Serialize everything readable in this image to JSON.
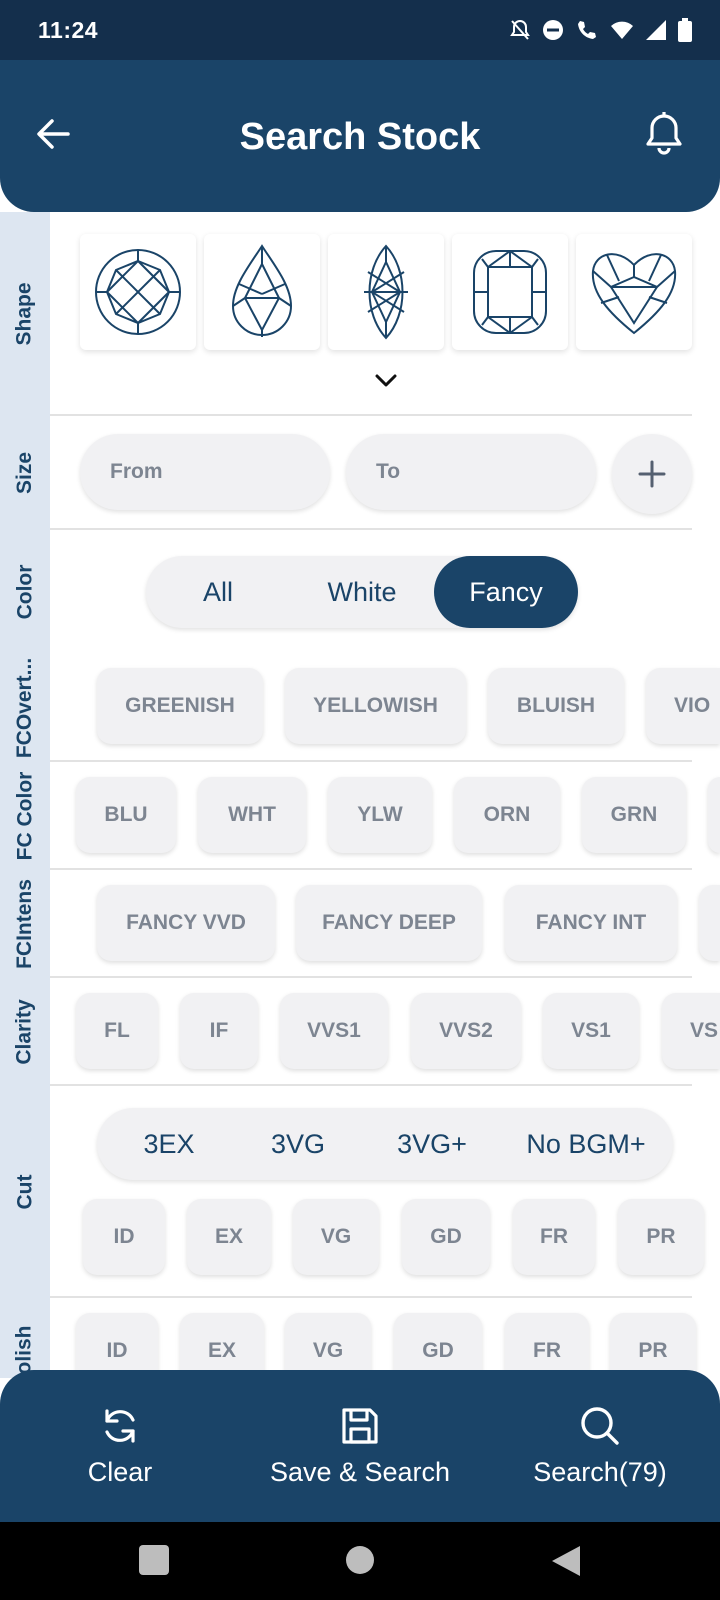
{
  "status_bar": {
    "time": "11:24"
  },
  "header": {
    "title": "Search Stock"
  },
  "sections": {
    "shape": "Shape",
    "size": "Size",
    "color": "Color",
    "fc_overtone": "FCOvert...",
    "fc_color": "FC Color",
    "fc_intensity": "FCIntens",
    "clarity": "Clarity",
    "cut": "Cut",
    "polish": "olish"
  },
  "size": {
    "from_placeholder": "From",
    "to_placeholder": "To"
  },
  "color_toggle": {
    "options": [
      "All",
      "White",
      "Fancy"
    ],
    "selected": "Fancy"
  },
  "fc_overtone_chips": [
    "GREENISH",
    "YELLOWISH",
    "BLUISH",
    "VIO"
  ],
  "fc_color_chips": [
    "BLU",
    "WHT",
    "YLW",
    "ORN",
    "GRN"
  ],
  "fc_intensity_chips": [
    "FANCY VVD",
    "FANCY DEEP",
    "FANCY INT"
  ],
  "clarity_chips": [
    "FL",
    "IF",
    "VVS1",
    "VVS2",
    "VS1",
    "VS"
  ],
  "cut_presets": [
    "3EX",
    "3VG",
    "3VG+",
    "No BGM+"
  ],
  "cut_chips": [
    "ID",
    "EX",
    "VG",
    "GD",
    "FR",
    "PR"
  ],
  "polish_chips": [
    "ID",
    "EX",
    "VG",
    "GD",
    "FR",
    "PR"
  ],
  "bottom_bar": {
    "clear": "Clear",
    "save_search": "Save & Search",
    "search": "Search(79)"
  },
  "colors": {
    "primary": "#1a4468",
    "status_bar": "#142f4c",
    "sidebar": "#dde6f1",
    "chip_bg": "#f1f1f3",
    "chip_text": "#7d8591"
  },
  "icons": [
    "back-arrow-icon",
    "bell-icon",
    "round-diamond-icon",
    "pear-diamond-icon",
    "marquise-diamond-icon",
    "cushion-diamond-icon",
    "heart-diamond-icon",
    "chevron-down-icon",
    "plus-icon",
    "refresh-icon",
    "save-icon",
    "search-icon"
  ]
}
